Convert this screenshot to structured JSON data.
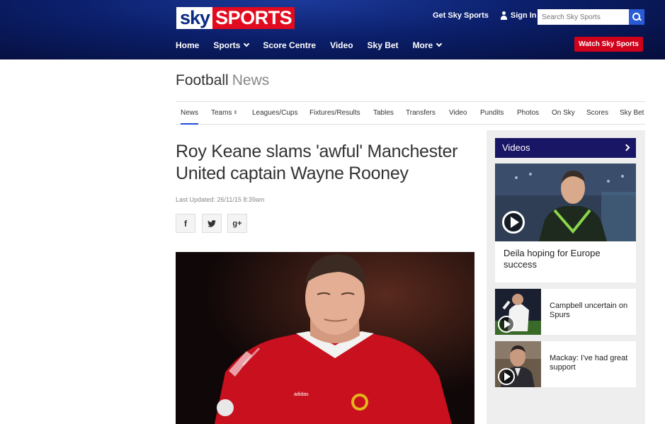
{
  "header": {
    "logo_sky": "sky",
    "logo_sports": "SPORTS",
    "get_sky_sports": "Get Sky Sports",
    "sign_in": "Sign In",
    "search_placeholder": "Search Sky Sports",
    "nav": [
      "Home",
      "Sports",
      "Score Centre",
      "Video",
      "Sky Bet",
      "More"
    ],
    "watch_button": "Watch Sky Sports"
  },
  "section": {
    "title": "Football",
    "subtitle": "News",
    "tabs": [
      "News",
      "Teams",
      "Leagues/Cups",
      "Fixtures/Results",
      "Tables",
      "Transfers",
      "Video",
      "Pundits",
      "Photos",
      "On Sky",
      "Scores",
      "Sky Bet"
    ],
    "active_tab": "News"
  },
  "article": {
    "headline": "Roy Keane slams 'awful' Manchester United captain Wayne Rooney",
    "last_updated": "Last Updated: 26/11/15 8:39am",
    "share": [
      "facebook",
      "twitter",
      "google-plus"
    ]
  },
  "sidebar": {
    "heading": "Videos",
    "items": [
      {
        "title": "Deila hoping for Europe success"
      },
      {
        "title": "Campbell uncertain on Spurs"
      },
      {
        "title": "Mackay: I've had great support"
      }
    ]
  },
  "colors": {
    "brand_blue": "#0b1f6b",
    "brand_red": "#e10a1e",
    "videos_header": "#1a1666",
    "search_button": "#2a5bd7"
  }
}
